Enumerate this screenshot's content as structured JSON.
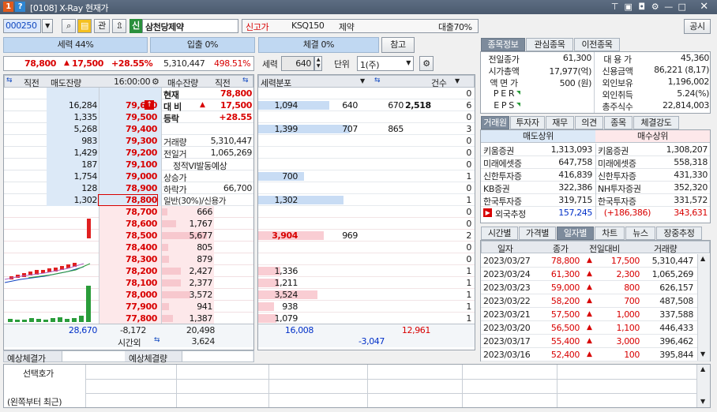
{
  "window": {
    "title": "[0108] X-Ray 현재가"
  },
  "toolbar": {
    "code": "000250",
    "name": "삼천당제약",
    "tag1": "신고가",
    "index": "KSQ150",
    "sector": "제약",
    "loan": "대출70%",
    "kwan": "관",
    "sin": "신",
    "notice": "공시"
  },
  "strength": {
    "seller": "세력 44%",
    "entry": "입출 0%",
    "trade": "체결 0%",
    "ref": "참고"
  },
  "price_line": {
    "price": "78,800",
    "change": "17,500",
    "pct": "+28.55%",
    "volume": "5,310,447",
    "ratio": "498.51%",
    "seryeok_label": "세력",
    "seryeok_val": "640",
    "unit_label": "단위",
    "unit_val": "1(주)"
  },
  "ob_header": {
    "c1": "직전",
    "c2": "매도잔량",
    "time": "16:00:00",
    "c4": "매수잔량",
    "c5": "직전",
    "dist": "세력분포",
    "cnt": "건수"
  },
  "asks": [
    {
      "vol": "",
      "price": "",
      "dist": [
        "",
        "",
        "",
        ""
      ],
      "cnt": "0"
    },
    {
      "vol": "16,284",
      "price": "79,600",
      "dist": [
        "1,094",
        "640",
        "670",
        "2,518"
      ],
      "cnt": "6"
    },
    {
      "vol": "1,335",
      "price": "79,500",
      "dist": [
        "",
        "",
        "",
        ""
      ],
      "cnt": "0"
    },
    {
      "vol": "5,268",
      "price": "79,400",
      "dist": [
        "1,399",
        "707",
        "865",
        ""
      ],
      "cnt": "3"
    },
    {
      "vol": "983",
      "price": "79,300",
      "dist": [
        "",
        "",
        "",
        ""
      ],
      "cnt": "0"
    },
    {
      "vol": "1,429",
      "price": "79,200",
      "dist": [
        "",
        "",
        "",
        ""
      ],
      "cnt": "0"
    },
    {
      "vol": "187",
      "price": "79,100",
      "dist": [
        "",
        "",
        "",
        ""
      ],
      "cnt": "0"
    },
    {
      "vol": "1,754",
      "price": "79,000",
      "dist": [
        "700",
        "",
        "",
        ""
      ],
      "cnt": "1"
    },
    {
      "vol": "128",
      "price": "78,900",
      "dist": [
        "",
        "",
        "",
        ""
      ],
      "cnt": "0"
    },
    {
      "vol": "1,302",
      "price": "78,800",
      "dist": [
        "1,302",
        "",
        "",
        ""
      ],
      "cnt": "1"
    }
  ],
  "info": [
    {
      "label": "현재",
      "value": "78,800"
    },
    {
      "label": "대 비",
      "value": "17,500"
    },
    {
      "label": "등락",
      "value": "+28.55"
    },
    {
      "label": "",
      "value": ""
    },
    {
      "label": "거래량",
      "value": "5,310,447"
    },
    {
      "label": "전일거",
      "value": "1,065,269"
    },
    {
      "label": "정적VI발동예상",
      "value": ""
    },
    {
      "label": "상승가",
      "value": ""
    },
    {
      "label": "하락가",
      "value": "66,700"
    },
    {
      "label": "일반(30%)/신용가",
      "value": ""
    }
  ],
  "bids": [
    {
      "price": "78,700",
      "vol": "666",
      "dist": "",
      "dist2": "",
      "cnt": "0"
    },
    {
      "price": "78,600",
      "vol": "1,767",
      "dist": "",
      "dist2": "",
      "cnt": "0"
    },
    {
      "price": "78,500",
      "vol": "5,677",
      "dist": "3,904",
      "dist2": "969",
      "cnt": "2"
    },
    {
      "price": "78,400",
      "vol": "805",
      "dist": "",
      "dist2": "",
      "cnt": "0"
    },
    {
      "price": "78,300",
      "vol": "879",
      "dist": "",
      "dist2": "",
      "cnt": "0"
    },
    {
      "price": "78,200",
      "vol": "2,427",
      "dist": "1,336",
      "dist2": "",
      "cnt": "1"
    },
    {
      "price": "78,100",
      "vol": "2,377",
      "dist": "1,211",
      "dist2": "",
      "cnt": "1"
    },
    {
      "price": "78,000",
      "vol": "3,572",
      "dist": "3,524",
      "dist2": "",
      "cnt": "1"
    },
    {
      "price": "77,900",
      "vol": "941",
      "dist": "938",
      "dist2": "",
      "cnt": "1"
    },
    {
      "price": "77,800",
      "vol": "1,387",
      "dist": "1,079",
      "dist2": "",
      "cnt": "1"
    }
  ],
  "totals": {
    "ask_total": "28,670",
    "diff": "-8,172",
    "bid_total": "20,498",
    "dist_left": "16,008",
    "dist_right": "12,961",
    "after_label": "시간외",
    "after_val": "3,624",
    "dist_diff": "-3,047"
  },
  "expected": {
    "price_label": "예상체결가",
    "qty_label": "예상체결량"
  },
  "bottom": {
    "label1": "선택호가",
    "label2": "(왼쪽부터 최근)"
  },
  "rtabs": [
    "종목정보",
    "관심종목",
    "이전종목"
  ],
  "stock_info": {
    "left": [
      [
        "전일종가",
        "61,300"
      ],
      [
        "시가총액",
        "17,977(억)"
      ],
      [
        "액 면 가",
        "500 (원)"
      ],
      [
        "P E R",
        ""
      ],
      [
        "E P S",
        ""
      ]
    ],
    "right": [
      [
        "대 용 가",
        "45,360"
      ],
      [
        "신용금액",
        "86,221 (8,17)"
      ],
      [
        "외인보유",
        "1,196,002"
      ],
      [
        "외인취득",
        "5.24(%)"
      ],
      [
        "총주식수",
        "22,814,003"
      ]
    ]
  },
  "brokers_tabs": [
    "거래원",
    "투자자",
    "재무",
    "의견",
    "종목",
    "체결강도"
  ],
  "brokers": {
    "sell_hdr": "매도상위",
    "buy_hdr": "매수상위",
    "rows": [
      [
        "키움증권",
        "1,313,093",
        "키움증권",
        "1,308,207"
      ],
      [
        "미래에셋증",
        "647,758",
        "미래에셋증",
        "558,318"
      ],
      [
        "신한투자증",
        "416,839",
        "신한투자증",
        "431,330"
      ],
      [
        "KB증권",
        "322,386",
        "NH투자증권",
        "352,320"
      ],
      [
        "한국투자증",
        "319,715",
        "한국투자증",
        "331,572"
      ]
    ],
    "foreign": [
      "외국추정",
      "157,245",
      "(+186,386)",
      "343,631"
    ]
  },
  "hist_tabs": [
    "시간별",
    "가격별",
    "일자별",
    "차트",
    "뉴스",
    "장중추정"
  ],
  "hist_hdr": [
    "일자",
    "종가",
    "전일대비",
    "거래량"
  ],
  "history": [
    [
      "2023/03/27",
      "78,800",
      "17,500",
      "5,310,447"
    ],
    [
      "2023/03/24",
      "61,300",
      "2,300",
      "1,065,269"
    ],
    [
      "2023/03/23",
      "59,000",
      "800",
      "626,157"
    ],
    [
      "2023/03/22",
      "58,200",
      "700",
      "487,508"
    ],
    [
      "2023/03/21",
      "57,500",
      "1,000",
      "337,588"
    ],
    [
      "2023/03/20",
      "56,500",
      "1,100",
      "446,433"
    ],
    [
      "2023/03/17",
      "55,400",
      "3,000",
      "396,462"
    ],
    [
      "2023/03/16",
      "52,400",
      "100",
      "395,844"
    ]
  ],
  "colors": {
    "up": "#d80000",
    "down": "#0030c8",
    "title": "#52627a",
    "tab_on": "#7d8b9c"
  }
}
